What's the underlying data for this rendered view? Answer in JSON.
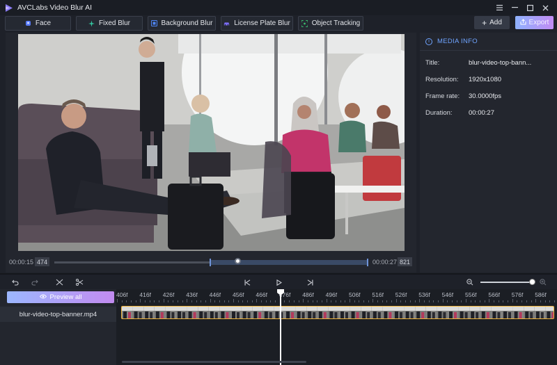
{
  "app": {
    "title": "AVCLabs Video Blur AI"
  },
  "window_controls": [
    "menu-icon",
    "minimize-icon",
    "maximize-icon",
    "close-icon"
  ],
  "toolbar": {
    "modes": [
      {
        "label": "Face",
        "icon": "face-icon",
        "color": "#5a7cff"
      },
      {
        "label": "Fixed Blur",
        "icon": "fixed-blur-icon",
        "color": "#34c6a0"
      },
      {
        "label": "Background Blur",
        "icon": "background-blur-icon",
        "color": "#4f86f7"
      },
      {
        "label": "License Plate Blur",
        "icon": "car-icon",
        "color": "#7a6cf2"
      },
      {
        "label": "Object Tracking",
        "icon": "tracking-icon",
        "color": "#39c06e"
      }
    ],
    "add_label": "Add",
    "export_label": "Export"
  },
  "scrubber": {
    "start_time": "00:00:15",
    "start_frame": "474",
    "end_time": "00:00:27",
    "end_frame": "821"
  },
  "media_info": {
    "heading": "MEDIA INFO",
    "rows": [
      {
        "key": "Title:",
        "value": "blur-video-top-bann..."
      },
      {
        "key": "Resolution:",
        "value": "1920x1080"
      },
      {
        "key": "Frame rate:",
        "value": "30.0000fps"
      },
      {
        "key": "Duration:",
        "value": "00:00:27"
      }
    ]
  },
  "timeline": {
    "preview_all_label": "Preview all",
    "file_name": "blur-video-top-banner.mp4",
    "ruler_labels": [
      "406f",
      "416f",
      "426f",
      "436f",
      "446f",
      "456f",
      "466f",
      "476f",
      "486f",
      "496f",
      "506f",
      "516f",
      "526f",
      "536f",
      "546f",
      "556f",
      "566f",
      "576f",
      "586f"
    ]
  },
  "colors": {
    "accent": "#6fa4ff",
    "clip_border": "#f0b43c",
    "export_gradient_start": "#8fb2ff",
    "export_gradient_end": "#c18cf3"
  }
}
